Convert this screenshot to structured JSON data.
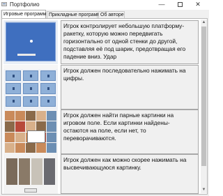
{
  "window": {
    "title": "Портфолио",
    "minimize_glyph": "—",
    "close_glyph": "✕"
  },
  "tabs": [
    {
      "label": "Игровые программы",
      "active": true
    },
    {
      "label": "Прикладные программы",
      "active": false
    },
    {
      "label": "Об авторе",
      "active": false
    }
  ],
  "projects": [
    {
      "image": "platformer-game-screenshot",
      "description": "Игрок контролирует небольшую платформу-ракетку, которую можно передвигать горизонтально от одной стенки до другой, подставляя её под шарик, предотвращая его падение вниз. Удар"
    },
    {
      "image": "number-grid-game-screenshot",
      "description": "Игрок должен последовательно нажимать на цифры."
    },
    {
      "image": "memory-pairs-game-screenshot",
      "description": "Игрок должен найти парные картинки на игровом поле. Если картинки найдены- остаются на поле, если нет, то переворачиваются."
    },
    {
      "image": "reaction-wolves-game-screenshot",
      "description": "Игрок должен как можно скорее нажимать на высвечивающуюся картинку."
    }
  ],
  "scrollbar": {
    "up_glyph": "▲",
    "down_glyph": "▼"
  }
}
